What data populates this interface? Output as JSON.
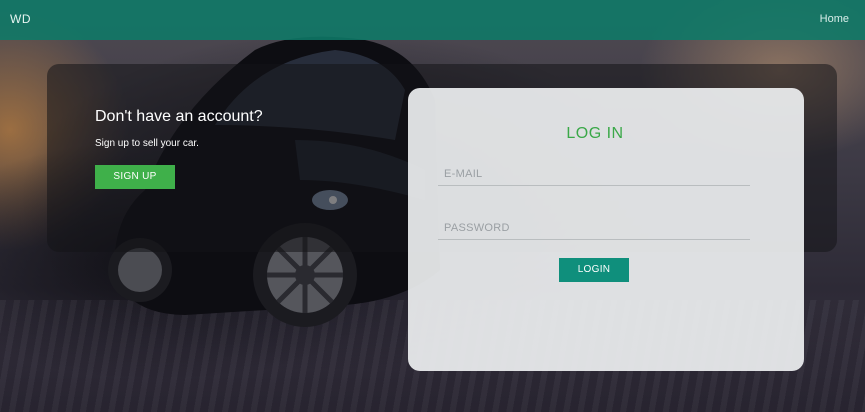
{
  "navbar": {
    "brand": "WD",
    "home_label": "Home",
    "background_color": "#0e7a68"
  },
  "signup": {
    "title": "Don't have an account?",
    "subtitle": "Sign up to sell your car.",
    "button_label": "SIGN UP",
    "button_color": "#3fb04a"
  },
  "login": {
    "title": "LOG IN",
    "email_placeholder": "E-MAIL",
    "password_placeholder": "PASSWORD",
    "button_label": "LOGIN",
    "title_color": "#3aa848",
    "button_color": "#0f8f7c"
  },
  "background": {
    "icon": "sports-car-photo"
  }
}
